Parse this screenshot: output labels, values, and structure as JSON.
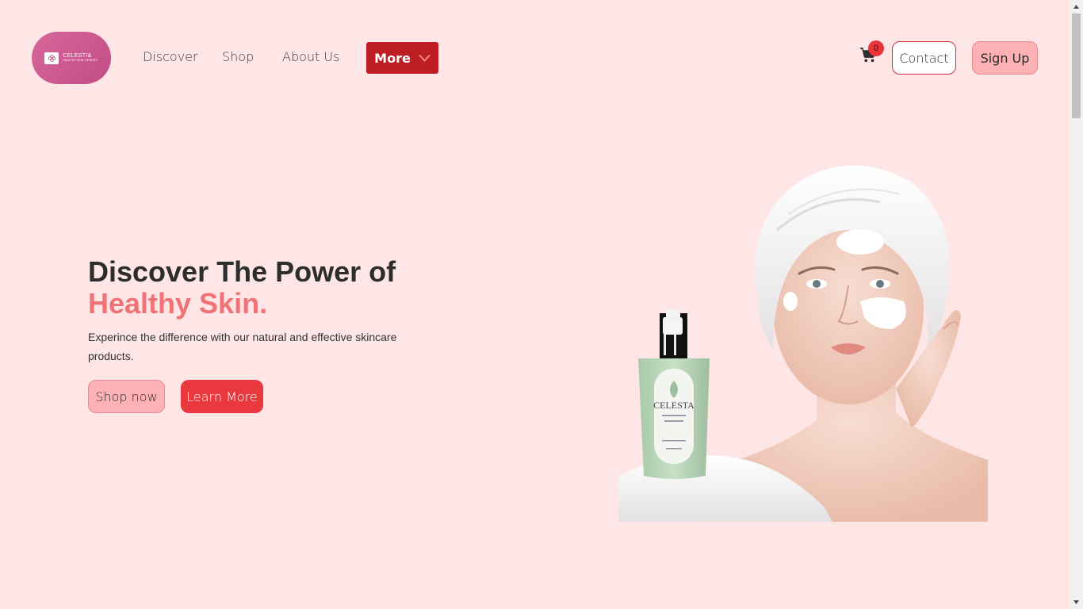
{
  "brand": {
    "name": "CELESTI&",
    "tagline": "HEALTHY SKIN THERAPY"
  },
  "nav": {
    "discover": "Discover",
    "shop": "Shop",
    "about": "About Us",
    "more": "More"
  },
  "header": {
    "cart_count": "0",
    "contact": "Contact",
    "signup": "Sign Up"
  },
  "hero": {
    "title": "Discover The Power of",
    "accent": "Healthy Skin.",
    "description": "Experince the difference with our natural and effective skincare products.",
    "shop_now": "Shop now",
    "learn_more": "Learn More",
    "product_label": "CELESTA"
  },
  "colors": {
    "background": "#fee5e6",
    "accent_red": "#bd1e23",
    "accent_pink": "#f07276",
    "button_pink": "#ffb2b6",
    "button_red": "#e9383e"
  }
}
